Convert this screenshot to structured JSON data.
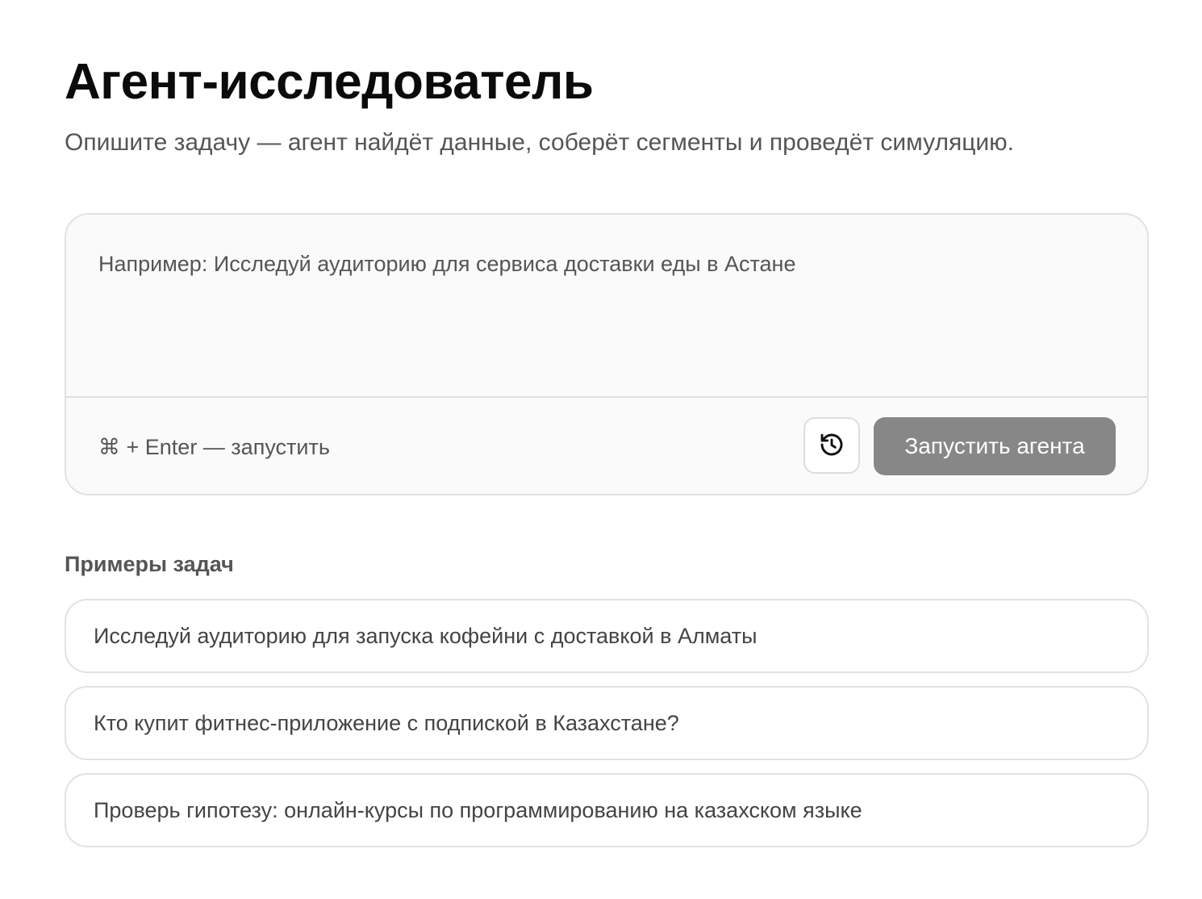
{
  "header": {
    "title": "Агент-исследователь",
    "subtitle": "Опишите задачу — агент найдёт данные, соберёт сегменты и проведёт симуляцию."
  },
  "composer": {
    "placeholder": "Например: Исследуй аудиторию для сервиса доставки еды в Астане",
    "value": "",
    "shortcut_hint": "⌘ + Enter — запустить",
    "history_icon": "history-icon",
    "run_button_label": "Запустить агента"
  },
  "examples": {
    "heading": "Примеры задач",
    "items": [
      {
        "label": "Исследуй аудиторию для запуска кофейни с доставкой в Алматы"
      },
      {
        "label": "Кто купит фитнес-приложение с подпиской в Казахстане?"
      },
      {
        "label": "Проверь гипотезу: онлайн-курсы по программированию на казахском языке"
      }
    ]
  },
  "colors": {
    "background": "#ffffff",
    "composer_background": "#fafafa",
    "border": "#e2e2e2",
    "run_button_background": "#878787",
    "run_button_text": "#ffffff",
    "muted_text": "#555555"
  }
}
